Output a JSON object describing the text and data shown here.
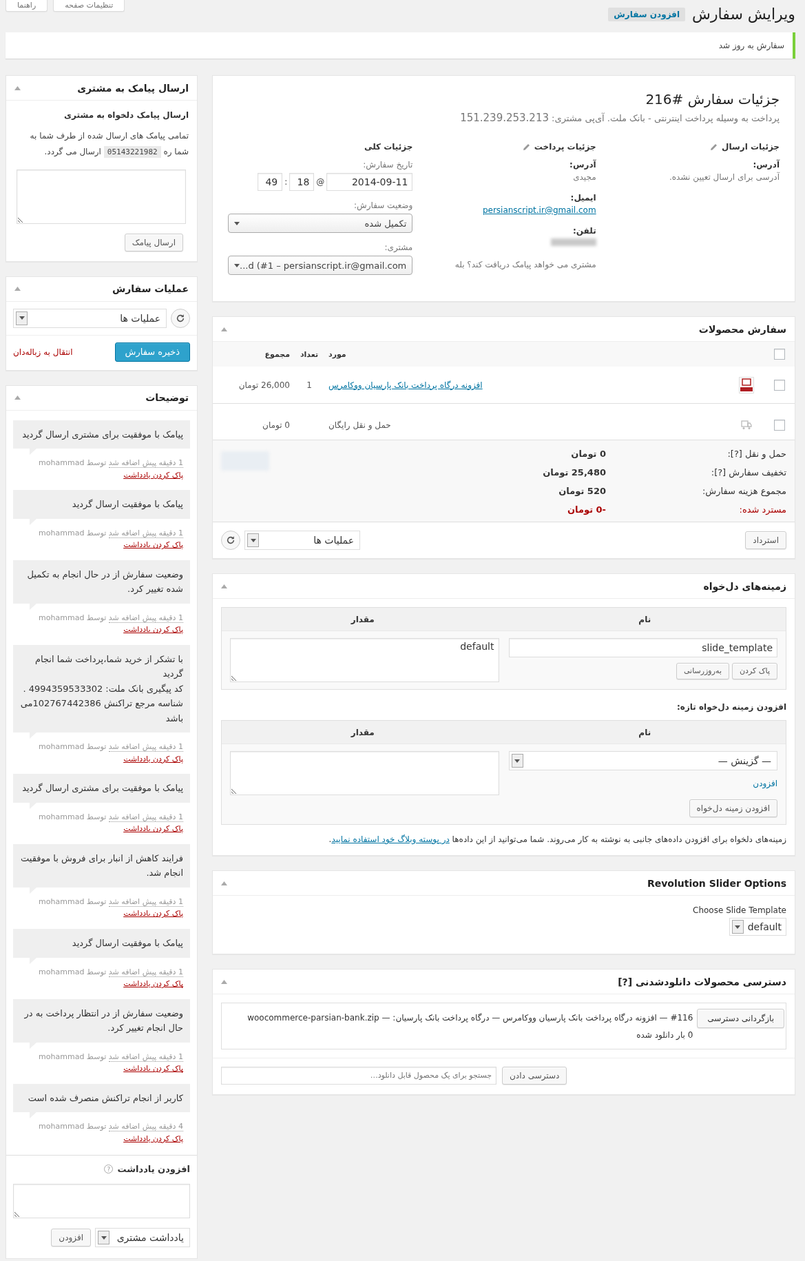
{
  "screen_tabs": [
    {
      "label": "تنظیمات صفحه"
    },
    {
      "label": "راهنما"
    }
  ],
  "header": {
    "title": "ویرایش سفارش",
    "add_button": "افزودن سفارش"
  },
  "notice": "سفارش به روز شد",
  "order_details": {
    "title": "جزئیات سفارش #216",
    "payment_note": "پرداخت به وسیله پرداخت اینترنتی - بانک ملت. آی‌پی مشتری:",
    "ip": "151.239.253.213",
    "shipping": {
      "heading": "جزئیات ارسال",
      "address_label": "آدرس:",
      "address": "آدرسی برای ارسال تعیین نشده."
    },
    "billing": {
      "heading": "جزئیات پرداخت",
      "address_label": "آدرس:",
      "address": "مجیدی",
      "email_label": "ایمیل:",
      "email": "persianscript.ir@gmail.com",
      "phone_label": "تلفن:",
      "sms_note": "مشتری می خواهد پیامک دریافت کند؟ بله"
    },
    "general": {
      "heading": "جزئیات کلی",
      "date_label": "تاریخ سفارش:",
      "date": "2014-09-11",
      "at": "@",
      "hour": "18",
      "colon": ":",
      "minute": "49",
      "status_label": "وضعیت سفارش:",
      "status": "تکمیل شده",
      "customer_label": "مشتری:",
      "customer": "...d (#1 – persianscript.ir@gmail.com"
    }
  },
  "products": {
    "title": "سفارش محصولات",
    "columns": [
      "مورد",
      "تعداد",
      "مجموع"
    ],
    "header_checked": false,
    "rows": [
      {
        "kind": "product",
        "checked": false,
        "name": "افزونه درگاه پرداخت بانک پارسیان ووکامرس",
        "qty": "1",
        "total": "26,000 تومان"
      },
      {
        "kind": "shipping",
        "checked": false,
        "name": "حمل و نقل رایگان",
        "total": "0 تومان"
      }
    ],
    "totals": [
      {
        "kind": "normal",
        "label": "حمل و نقل [?]:",
        "value": "0 تومان"
      },
      {
        "kind": "normal",
        "label": "تخفیف سفارش [?]:",
        "value": "25,480 تومان"
      },
      {
        "kind": "normal",
        "label": "مجموع هزینه سفارش:",
        "value": "520 تومان"
      },
      {
        "kind": "refund",
        "label": "مسترد شده:",
        "value": "-0 تومان"
      }
    ],
    "refund_button": "استرداد",
    "actions_select": "عملیات ها"
  },
  "custom_fields": {
    "title": "زمینه‌های دل‌خواه",
    "columns": [
      "نام",
      "مقدار"
    ],
    "rows": [
      {
        "name": "slide_template",
        "value": "default",
        "delete_button": "پاک کردن",
        "update_button": "به‌روزرسانی"
      }
    ],
    "add_heading": "افزودن زمینه دل‌خواه تازه:",
    "new_columns": [
      "نام",
      "مقدار"
    ],
    "select": "— گزینش —",
    "enter_new_link": "افزودن",
    "add_button": "افزودن زمینه دل‌خواه",
    "help_before": "زمینه‌های دلخواه برای افزودن داده‌های جانبی به نوشته به کار می‌روند. شما می‌توانید از این داده‌ها",
    "help_link": "در پوسته وبلاگ خود استفاده نمایید",
    "help_after": "."
  },
  "revslider": {
    "title": "Revolution Slider Options",
    "label": "Choose Slide Template",
    "select": "default"
  },
  "downloads": {
    "title": "دسترسی محصولات دانلودشدنی [?]",
    "items": [
      {
        "revoke_button": "بازگردانی دسترسی",
        "file": "#116 — افزونه درگاه پرداخت بانک پارسیان ووکامرس — درگاه پرداخت بانک پارسیان: — woocommerce-parsian-bank.zip",
        "count": "0 بار دانلود شده"
      }
    ],
    "search_placeholder": "جستجو برای یک محصول قابل دانلود…",
    "grant_button": "دسترسی دادن"
  },
  "sms": {
    "title": "ارسال پیامک به مشتری",
    "subtitle": "ارسال پیامک دلخواه به مشتری",
    "text_before": "تمامی پیامک های ارسال شده از طرف شما به شما ره",
    "number": "05143221982",
    "text_after": "ارسال می گردد.",
    "button": "ارسال پیامک"
  },
  "order_actions": {
    "title": "عملیات سفارش",
    "select": "عملیات ها",
    "save_button": "ذخیره سفارش",
    "trash_link": "انتقال به زباله‌دان"
  },
  "notes": {
    "title": "توضیحات",
    "items": [
      {
        "text": "پیامک با موفقیت برای مشتری ارسال گردید",
        "added": "1 دقیقه پیش اضافه شد",
        "author": "توسط mohammad",
        "delete": "پاک کردن یادداشت"
      },
      {
        "text": "پیامک با موفقیت ارسال گردید",
        "added": "1 دقیقه پیش اضافه شد",
        "author": "توسط mohammad",
        "delete": "پاک کردن یادداشت"
      },
      {
        "text": "وضعیت سفارش از در حال انجام به تکمیل شده تغییر کرد.",
        "added": "1 دقیقه پیش اضافه شد",
        "author": "توسط mohammad",
        "delete": "پاک کردن یادداشت"
      },
      {
        "text": "با تشکر از خرید شما،پرداخت شما انجام گردید\nکد پیگیری بانک ملت: 4994359533302 . شناسه مرجع تراکنش 102767442386می باشد",
        "added": "1 دقیقه پیش اضافه شد",
        "author": "توسط mohammad",
        "delete": "پاک کردن یادداشت"
      },
      {
        "text": "پیامک با موفقیت برای مشتری ارسال گردید",
        "added": "1 دقیقه پیش اضافه شد",
        "author": "توسط mohammad",
        "delete": "پاک کردن یادداشت"
      },
      {
        "text": "فرایند کاهش از انبار برای فروش با موفقیت انجام شد.",
        "added": "1 دقیقه پیش اضافه شد",
        "author": "توسط mohammad",
        "delete": "پاک کردن یادداشت"
      },
      {
        "text": "پیامک با موفقیت ارسال گردید",
        "added": "1 دقیقه پیش اضافه شد",
        "author": "توسط mohammad",
        "delete": "پاک کردن یادداشت"
      },
      {
        "text": "وضعیت سفارش از در انتظار پرداخت به در حال انجام تغییر کرد.",
        "added": "1 دقیقه پیش اضافه شد",
        "author": "توسط mohammad",
        "delete": "پاک کردن یادداشت"
      },
      {
        "text": "کاربر از انجام تراکنش منصرف شده است",
        "added": "4 دقیقه پیش اضافه شد",
        "author": "توسط mohammad",
        "delete": "پاک کردن یادداشت"
      }
    ],
    "add_title": "افزودن یادداشت",
    "help_icon": "?",
    "note_type": "یادداشت مشتری",
    "add_button": "افزودن"
  }
}
